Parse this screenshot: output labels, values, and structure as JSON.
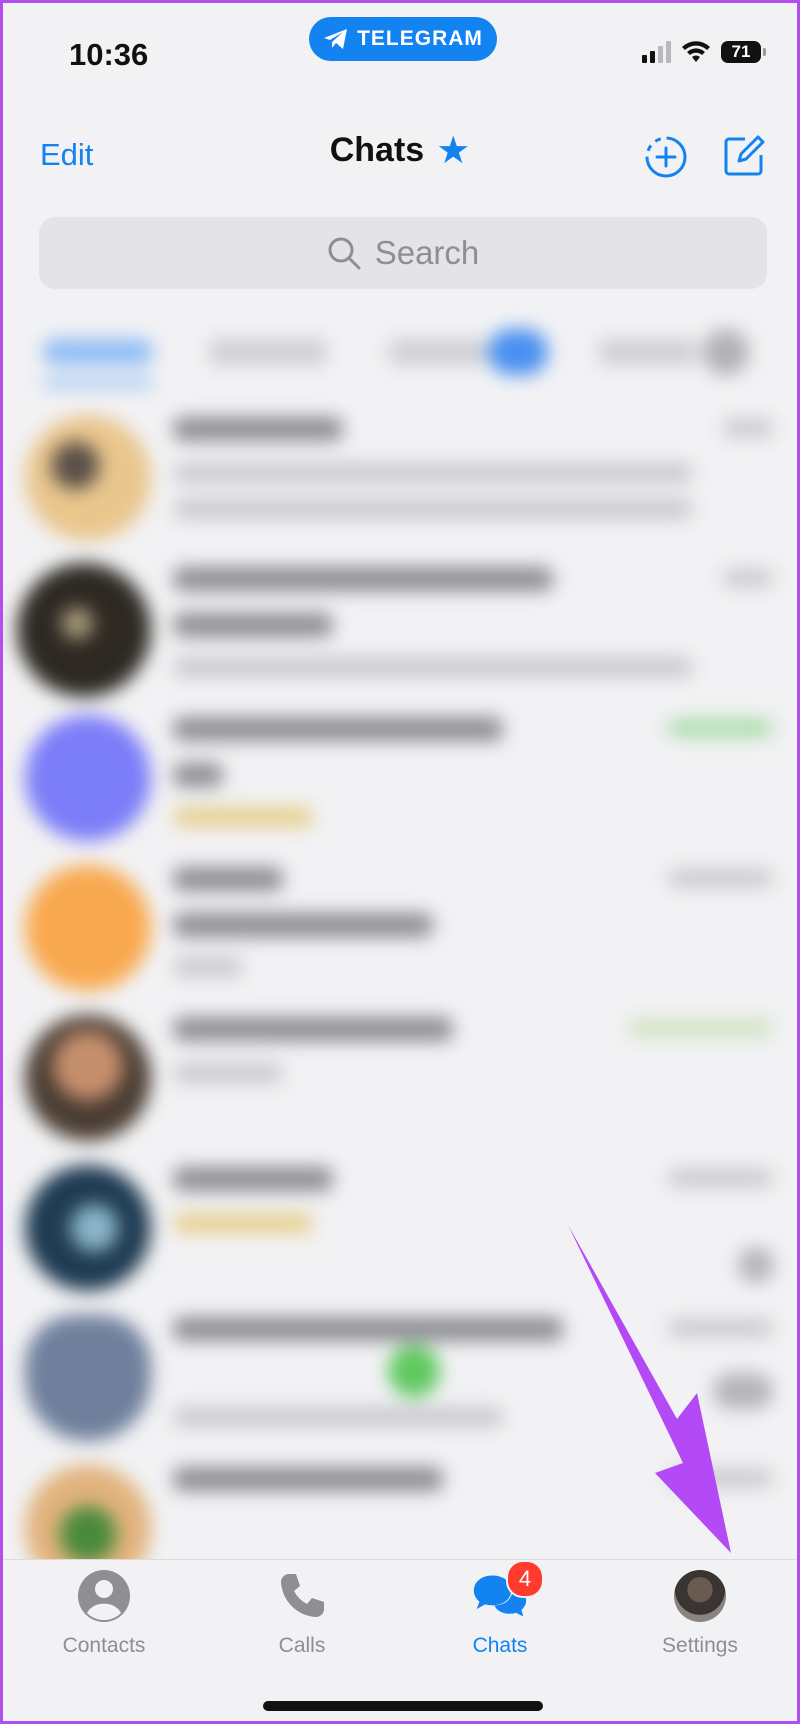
{
  "status_bar": {
    "time": "10:36",
    "app_pill": "TELEGRAM",
    "battery": "71"
  },
  "nav": {
    "edit_label": "Edit",
    "title": "Chats"
  },
  "search": {
    "placeholder": "Search"
  },
  "tabbar": {
    "tabs": [
      {
        "label": "Contacts",
        "icon": "person-circle-icon"
      },
      {
        "label": "Calls",
        "icon": "phone-icon"
      },
      {
        "label": "Chats",
        "icon": "chat-bubbles-icon",
        "badge": "4",
        "active": true
      },
      {
        "label": "Settings",
        "icon": "profile-avatar"
      }
    ]
  },
  "colors": {
    "accent": "#1283f0",
    "badge": "#ff3b30",
    "arrow": "#b34af5",
    "frame_border": "#b24df0"
  }
}
